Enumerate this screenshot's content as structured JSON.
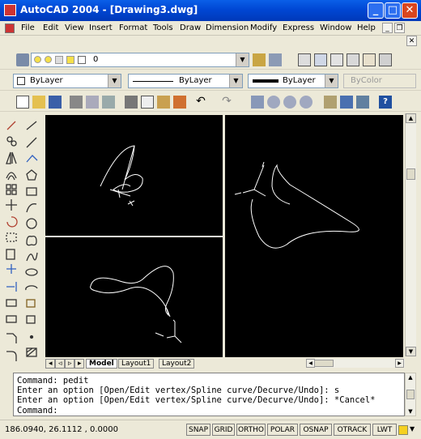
{
  "window": {
    "title": "AutoCAD 2004 - [Drawing3.dwg]"
  },
  "menu": {
    "items": [
      "File",
      "Edit",
      "View",
      "Insert",
      "Format",
      "Tools",
      "Draw",
      "Dimension",
      "Modify",
      "Express",
      "Window",
      "Help"
    ]
  },
  "layer_toolbar": {
    "layer_name": "0"
  },
  "properties_toolbar": {
    "color": "ByLayer",
    "linetype": "ByLayer",
    "lineweight": "ByLayer",
    "plotstyle": "ByColor"
  },
  "layout_tabs": [
    "Model",
    "Layout1",
    "Layout2"
  ],
  "command_line": {
    "lines": [
      "Command: pedit",
      "Enter an option [Open/Edit vertex/Spline curve/Decurve/Undo]: s",
      "Enter an option [Open/Edit vertex/Spline curve/Decurve/Undo]: *Cancel*"
    ],
    "prompt": "Command:"
  },
  "status_bar": {
    "coordinates": "186.0940, 26.1112 , 0.0000",
    "toggles": [
      "SNAP",
      "GRID",
      "ORTHO",
      "POLAR",
      "OSNAP",
      "OTRACK",
      "LWT"
    ]
  },
  "colors": {
    "title_bar": "#0047d4",
    "viewport_bg": "#000000",
    "chrome": "#ece9d8",
    "close_button": "#d9461f"
  },
  "icons": {
    "left_toolbar": [
      "line-icon",
      "construction-line-icon",
      "polyline-icon",
      "polygon-icon",
      "rectangle-icon",
      "arc-icon",
      "circle-icon",
      "revision-cloud-icon",
      "spline-icon",
      "ellipse-icon",
      "ellipse-arc-icon",
      "insert-block-icon",
      "make-block-icon",
      "point-icon",
      "hatch-icon",
      "region-icon",
      "table-icon",
      "multiline-text-icon"
    ]
  }
}
